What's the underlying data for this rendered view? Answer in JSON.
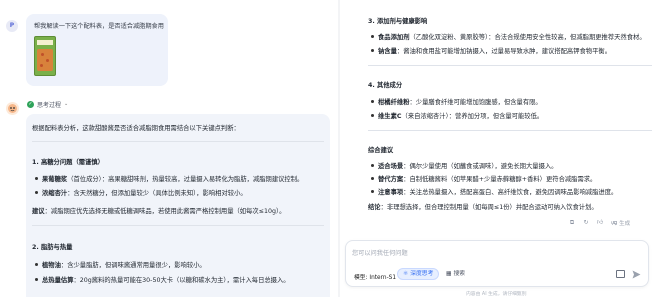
{
  "user": {
    "avatar_letter": "P",
    "message": "帮我解读一下这个配料表，是否适合减脂期食用"
  },
  "assistant": {
    "think_label": "思考过程",
    "intro": "根据配料表分析，这款甜酸酱是否适合减脂期食用需结合以下关键点判断：",
    "sections_left": [
      {
        "heading": "1. 高糖分问题（需谨慎）",
        "bullets": [
          {
            "key": "果葡糖浆",
            "text": "（首位成分）：高果糖甜味剂，热量较高，过量摄入易转化为脂肪，减脂期建议控制。"
          },
          {
            "key": "浓缩杏汁",
            "text": "：含天然糖分，但添加量较少（具体比例未知），影响相对较小。"
          }
        ],
        "note_key": "建议",
        "note": "：减脂期应优先选择无糖或低糖调味品，若使用此酱需严格控制用量（如每次≤10g）。"
      },
      {
        "heading": "2. 脂肪与热量",
        "bullets": [
          {
            "key": "植物油",
            "text": "：含少量脂肪，但调味酱通常用量很少，影响较小。"
          },
          {
            "key": "总热量估算",
            "text": "：20g酱料的热量可能在30-50大卡（以糖和碳水为主），需计入每日总摄入。"
          }
        ]
      }
    ],
    "sections_right": [
      {
        "heading": "3. 添加剂与健康影响",
        "bullets": [
          {
            "key": "食品添加剂",
            "text": "（乙酸化双淀粉、黄原胶等）：合法合规使用安全性较高，但减脂期更推荐天然食材。"
          },
          {
            "key": "钠含量",
            "text": "：酱油和食用盐可能增加钠摄入，过量易导致水肿，建议搭配高钾食物平衡。"
          }
        ]
      },
      {
        "heading": "4. 其他成分",
        "bullets": [
          {
            "key": "柑橘纤维粉",
            "text": "：少量膳食纤维可能增加饱腹感，但含量有限。"
          },
          {
            "key": "维生素C",
            "text": "（来自浓缩杏汁）：营养加分项，但含量可能较低。"
          }
        ]
      },
      {
        "heading": "综合建议",
        "bullets": [
          {
            "key": "适合场景",
            "text": "：偶尔少量使用（如蘸食或调味），避免长期大量摄入。"
          },
          {
            "key": "替代方案",
            "text": "：自制低糖酱料（如苹果醋+少量赤藓糖醇+香料）更符合减脂需求。"
          },
          {
            "key": "注意事项",
            "text": "：关注总热量摄入，搭配高蛋白、高纤维饮食，避免因调味品影响减脂进度。"
          }
        ]
      }
    ],
    "conclusion_key": "结论",
    "conclusion": "：非理想选择，但合理控制用量（如每周≤1份）并配合运动可纳入饮食计划。",
    "ai_note": "AI 生成"
  },
  "composer": {
    "placeholder": "您可以问我任何问题",
    "model_label": "模型:",
    "model_name": "Intern-S1",
    "think_chip": "深度思考",
    "search_chip": "搜索"
  },
  "footer": "内容由 AI 生成，请仔细甄别"
}
